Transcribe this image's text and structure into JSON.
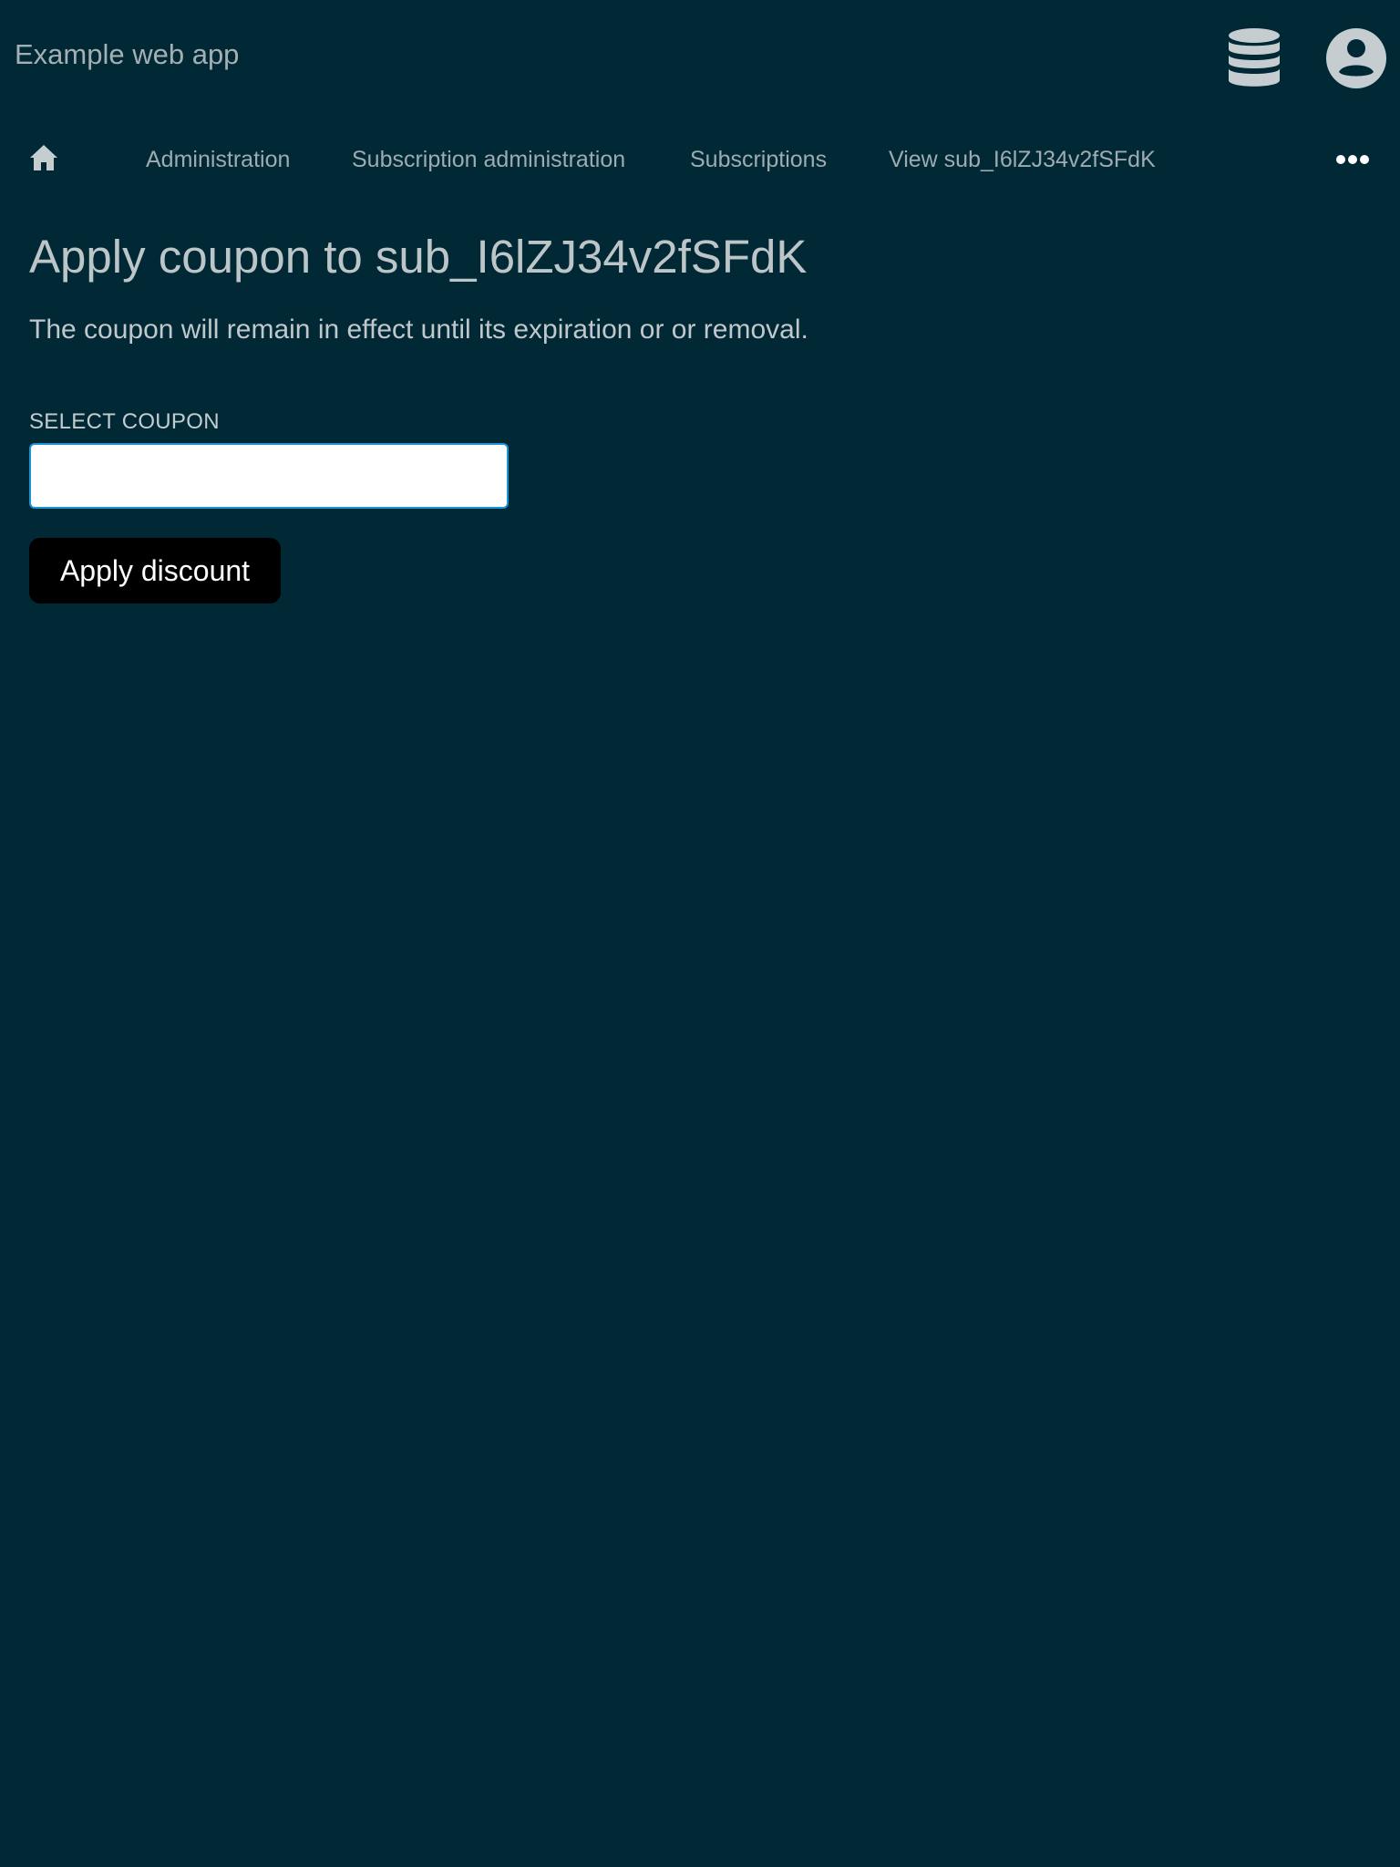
{
  "header": {
    "app_title": "Example web app",
    "icons": [
      "database-icon",
      "account-circle-icon"
    ]
  },
  "breadcrumb": {
    "home_icon": "home-icon",
    "items": [
      {
        "label": "Administration"
      },
      {
        "label": "Subscription administration"
      },
      {
        "label": "Subscriptions"
      },
      {
        "label": "View sub_I6lZJ34v2fSFdK"
      }
    ],
    "more_icon": "more-horizontal-icon"
  },
  "main": {
    "title": "Apply coupon to sub_I6lZJ34v2fSFdK",
    "description": "The coupon will remain in effect until its expiration or or removal.",
    "coupon_field": {
      "label": "SELECT COUPON",
      "value": "",
      "placeholder": ""
    },
    "submit_label": "Apply discount"
  },
  "colors": {
    "background": "#002835",
    "text": "#c6cdd0",
    "input_focus_border": "#1d94d3",
    "button_background": "#000000",
    "button_text": "#ffffff"
  }
}
